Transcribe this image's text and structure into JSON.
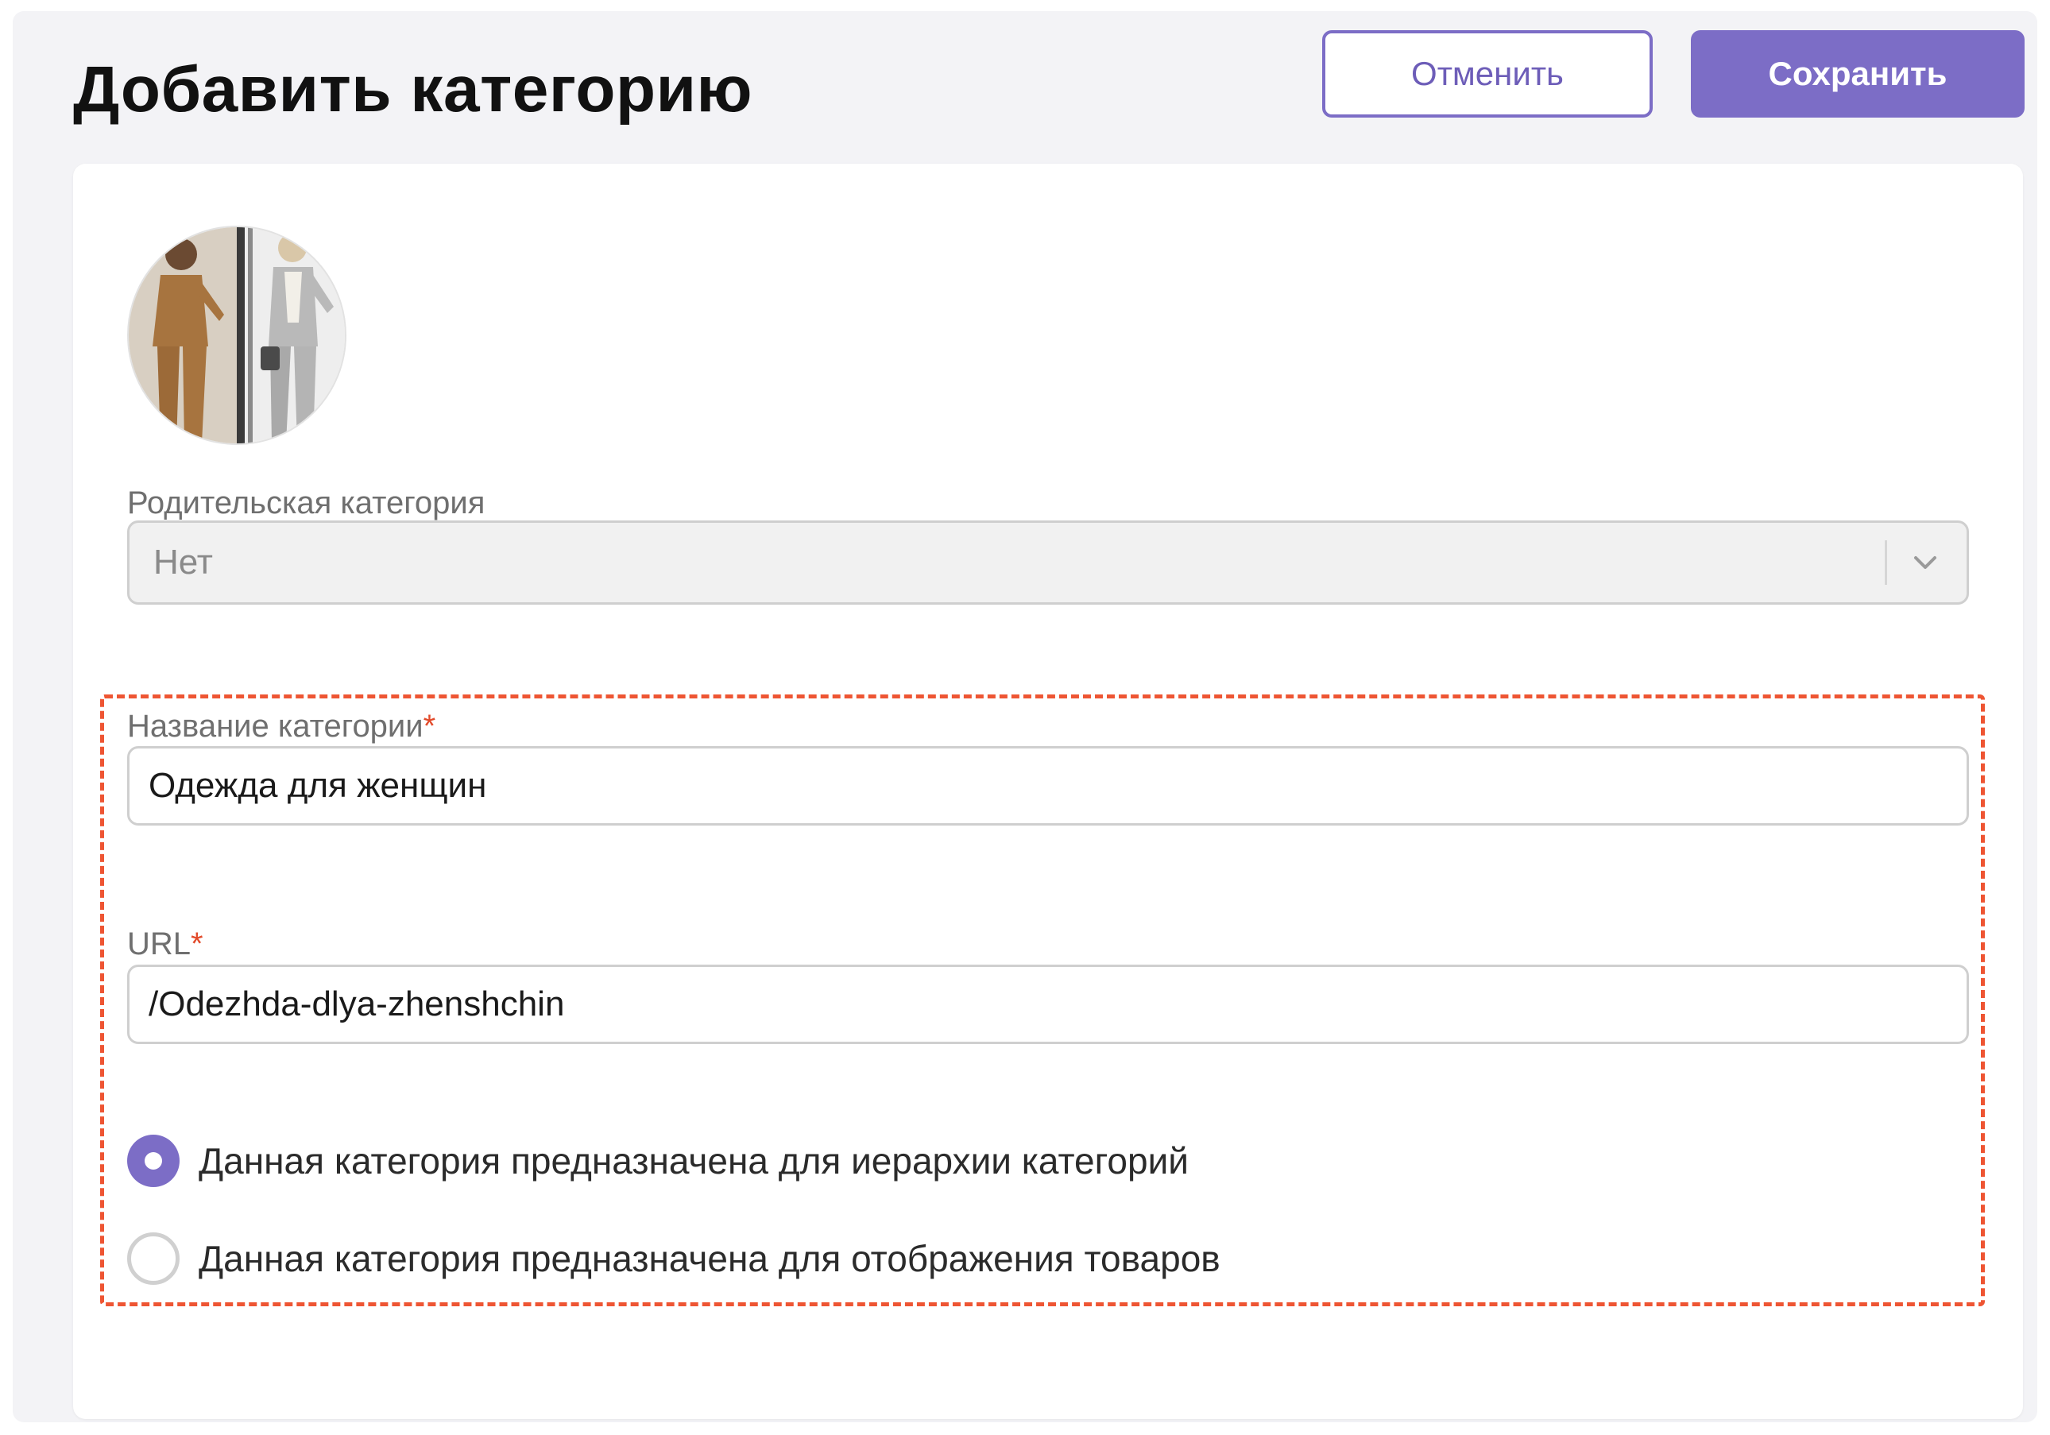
{
  "header": {
    "title": "Добавить категорию",
    "cancel_label": "Отменить",
    "save_label": "Сохранить"
  },
  "form": {
    "parent_category": {
      "label": "Родительская категория",
      "value": "Нет"
    },
    "category_name": {
      "label": "Название категории",
      "required_mark": "*",
      "value": "Одежда для женщин"
    },
    "url": {
      "label": "URL",
      "required_mark": "*",
      "value": "/Odezhda-dlya-zhenshchin"
    },
    "category_type": {
      "options": [
        {
          "label": "Данная категория предназначена для иерархии категорий",
          "selected": true
        },
        {
          "label": "Данная категория предназначена для отображения товаров",
          "selected": false
        }
      ]
    }
  },
  "colors": {
    "accent": "#7c6dc6",
    "required": "#e24a2a",
    "highlight": "#ee5533",
    "background": "#f3f3f6"
  },
  "icons": {
    "select_chevron": "chevron-down-icon"
  }
}
